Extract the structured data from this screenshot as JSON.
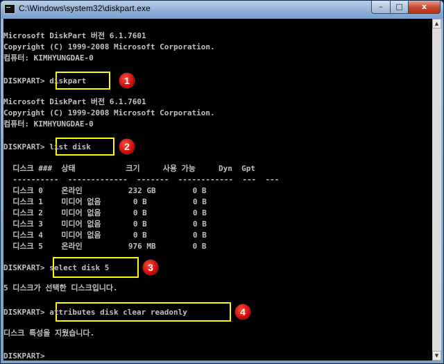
{
  "window": {
    "title": "C:\\Windows\\system32\\diskpart.exe",
    "controls": {
      "minimize": "–",
      "maximize": "□",
      "close": "x"
    }
  },
  "console": {
    "lines": [
      "Microsoft DiskPart 버전 6.1.7601",
      "Copyright (C) 1999-2008 Microsoft Corporation.",
      "컴퓨터: KIMHYUNGDAE-0",
      "DISKPART> diskpart",
      "Microsoft DiskPart 버전 6.1.7601",
      "Copyright (C) 1999-2008 Microsoft Corporation.",
      "컴퓨터: KIMHYUNGDAE-0",
      "DISKPART> list disk",
      "  디스크 ###  상태           크기     사용 가능     Dyn  Gpt",
      "  ----------  -------------  -------  ------------  ---  ---",
      "  디스크 0    온라인          232 GB        0 B",
      "  디스크 1    미디어 없음       0 B          0 B",
      "  디스크 2    미디어 없음       0 B          0 B",
      "  디스크 3    미디어 없음       0 B          0 B",
      "  디스크 4    미디어 없음       0 B          0 B",
      "  디스크 5    온라인          976 MB        0 B",
      "DISKPART> select disk 5",
      "5 디스크가 선택한 디스크입니다.",
      "DISKPART> attributes disk clear readonly",
      "디스크 특성을 지웠습니다.",
      "DISKPART>"
    ]
  },
  "annotations": {
    "steps": [
      "1",
      "2",
      "3",
      "4"
    ],
    "highlight_color": "#ffff00",
    "badge_color": "#e00000"
  },
  "colors": {
    "console_bg": "#000000",
    "console_text": "#c0c0c0"
  }
}
